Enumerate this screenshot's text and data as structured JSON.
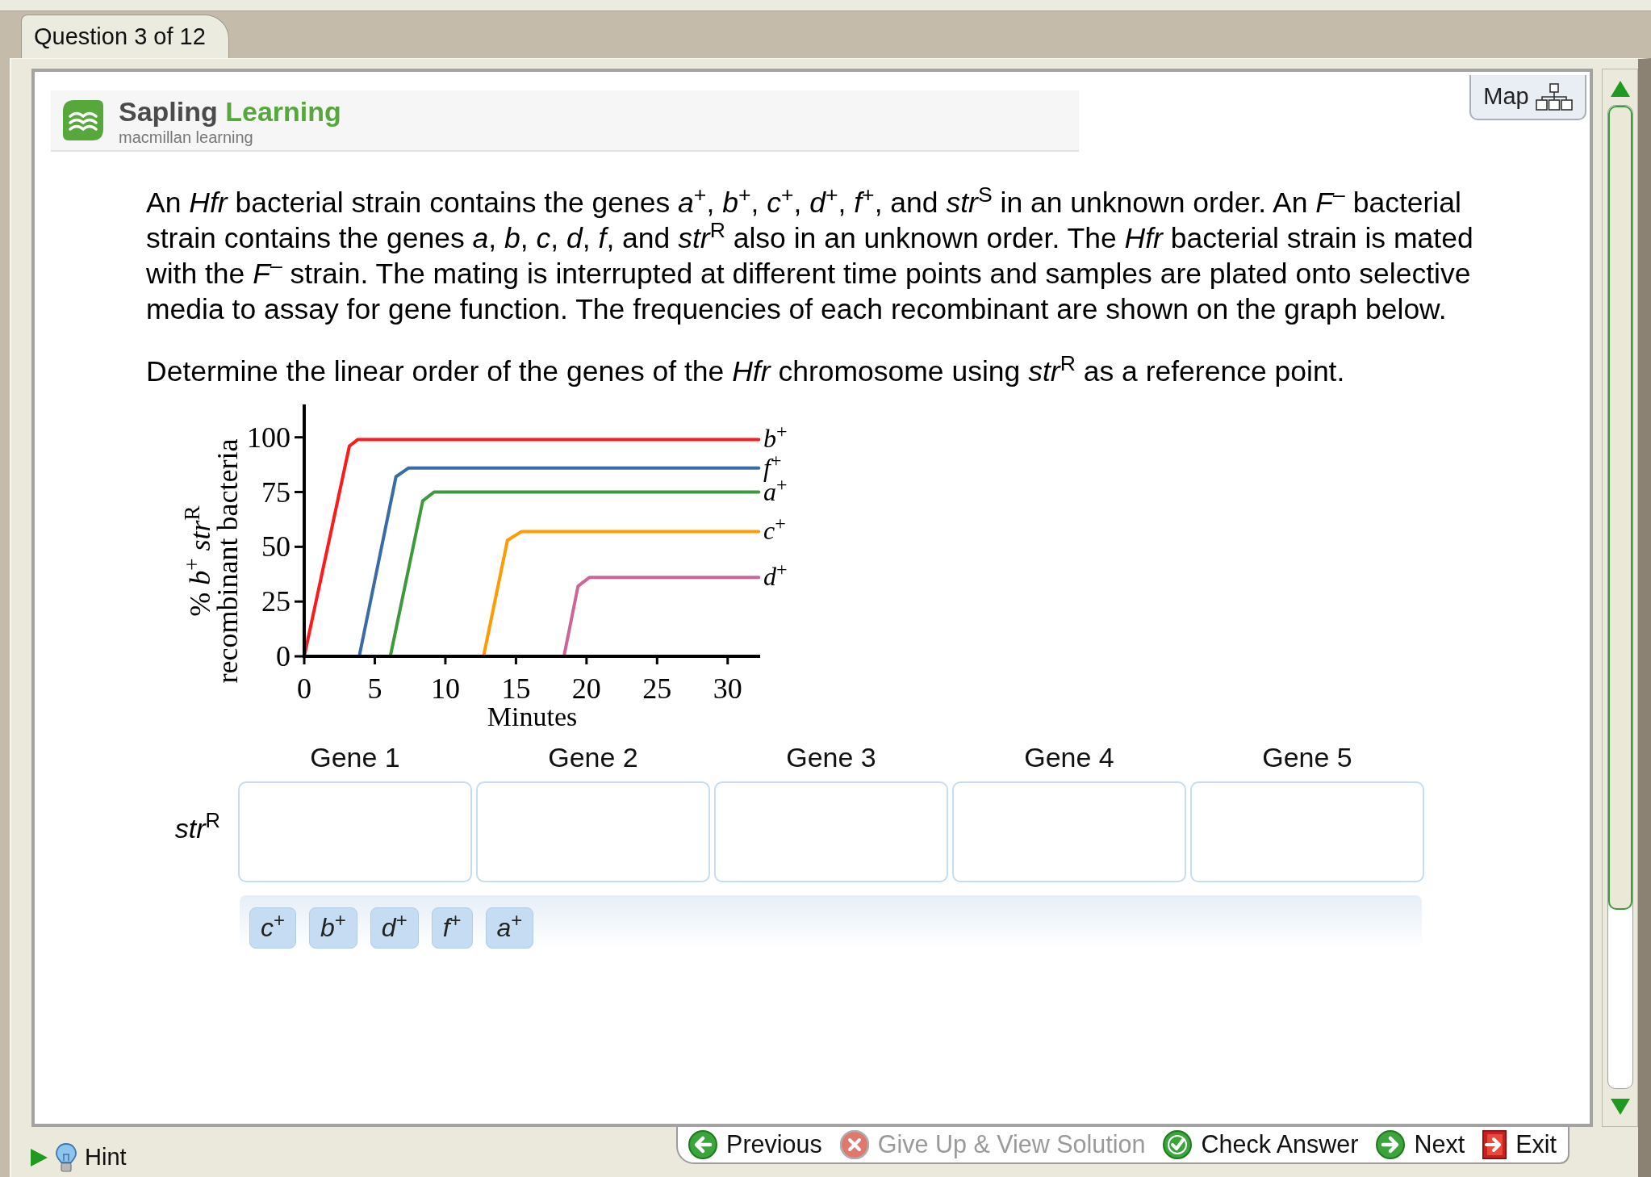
{
  "question_tab": "Question 3 of 12",
  "logo": {
    "name": "Sapling",
    "name_accent": "Learning",
    "tagline": "macmillan learning"
  },
  "map_button": "Map",
  "question": {
    "paragraphs": [
      "An *Hfr* bacterial strain contains the genes *a*$^{+}$, *b*$^{+}$, *c*$^{+}$, *d*$^{+}$, *f*$^{+}$, and *str*$^{S}$ in an unknown order. An *F*$^{–}$ bacterial strain contains the genes *a*, *b*, *c*, *d*, *f*, and *str*$^{R}$ also in an unknown order. The *Hfr* bacterial strain is mated with the *F*$^{–}$ strain. The mating is interrupted at different time points and samples are plated onto selective media to assay for gene function. The frequencies of each recombinant are shown on the graph below.",
      "Determine the linear order of the genes of the *Hfr* chromosome using *str*$^{R}$ as a reference point."
    ],
    "chart_data": {
      "type": "line",
      "xlabel": "Minutes",
      "ylabel": "% *b*$^{+}$ *str*$^{R}$ recombinant bacteria",
      "xlim": [
        0,
        32.3
      ],
      "ylim": [
        0,
        115
      ],
      "xticks": [
        0,
        5,
        10,
        15,
        20,
        25,
        30
      ],
      "yticks": [
        0,
        25,
        50,
        75,
        100
      ],
      "series": [
        {
          "name": "*b*$^{+}$",
          "color": "#ff1a1a",
          "x": [
            0,
            3.2,
            3.8,
            32.2
          ],
          "values": [
            0,
            96,
            99,
            99
          ]
        },
        {
          "name": "*f*$^{+}$",
          "color": "#3a6ba5",
          "x": [
            3.9,
            6.5,
            7.4,
            32.2
          ],
          "values": [
            0,
            82,
            86,
            86
          ]
        },
        {
          "name": "*a*$^{+}$",
          "color": "#3c9a3c",
          "x": [
            6.1,
            8.4,
            9.2,
            32.2
          ],
          "values": [
            0,
            71,
            75,
            75
          ]
        },
        {
          "name": "*c*$^{+}$",
          "color": "#ff9a00",
          "x": [
            12.7,
            14.4,
            15.4,
            32.2
          ],
          "values": [
            0,
            53,
            57,
            57
          ]
        },
        {
          "name": "*d*$^{+}$",
          "color": "#cc6699",
          "x": [
            18.4,
            19.4,
            20.2,
            32.2
          ],
          "values": [
            0,
            32,
            36,
            36
          ]
        }
      ]
    }
  },
  "answer_grid": {
    "row_label": "*str*$^{R}$",
    "columns": [
      "Gene 1",
      "Gene 2",
      "Gene 3",
      "Gene 4",
      "Gene 5"
    ]
  },
  "answer_tiles": [
    "*c*$^{+}$",
    "*b*$^{+}$",
    "*d*$^{+}$",
    "*f*$^{+}$",
    "*a*$^{+}$"
  ],
  "hint": {
    "label": "Hint",
    "expanded": false
  },
  "nav_buttons": [
    {
      "kind": "previous",
      "label": "Previous",
      "disabled": false
    },
    {
      "kind": "give_up",
      "label": "Give Up & View Solution",
      "disabled": true
    },
    {
      "kind": "check",
      "label": "Check Answer",
      "disabled": false
    },
    {
      "kind": "next",
      "label": "Next",
      "disabled": false
    },
    {
      "kind": "exit",
      "label": "Exit",
      "disabled": false
    }
  ]
}
